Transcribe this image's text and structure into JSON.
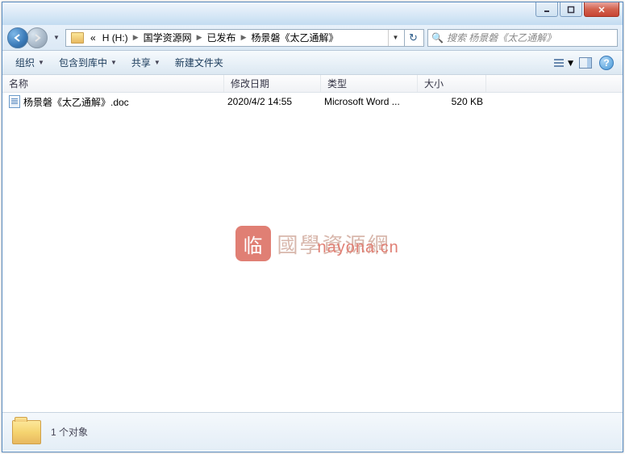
{
  "breadcrumb": {
    "prefix": "«",
    "items": [
      "H (H:)",
      "国学资源网",
      "已发布",
      "杨景磐《太乙通解》"
    ]
  },
  "search": {
    "placeholder": "搜索 杨景磐《太乙通解》"
  },
  "toolbar": {
    "organize": "组织",
    "library": "包含到库中",
    "share": "共享",
    "newfolder": "新建文件夹"
  },
  "columns": {
    "name": "名称",
    "date": "修改日期",
    "type": "类型",
    "size": "大小"
  },
  "files": [
    {
      "name": "杨景磐《太乙通解》.doc",
      "date": "2020/4/2 14:55",
      "type": "Microsoft Word ...",
      "size": "520 KB"
    }
  ],
  "status": {
    "count": "1 个对象"
  },
  "watermark": {
    "badge": "临",
    "text1": "國學資源網",
    "text2": "nayona.cn"
  }
}
